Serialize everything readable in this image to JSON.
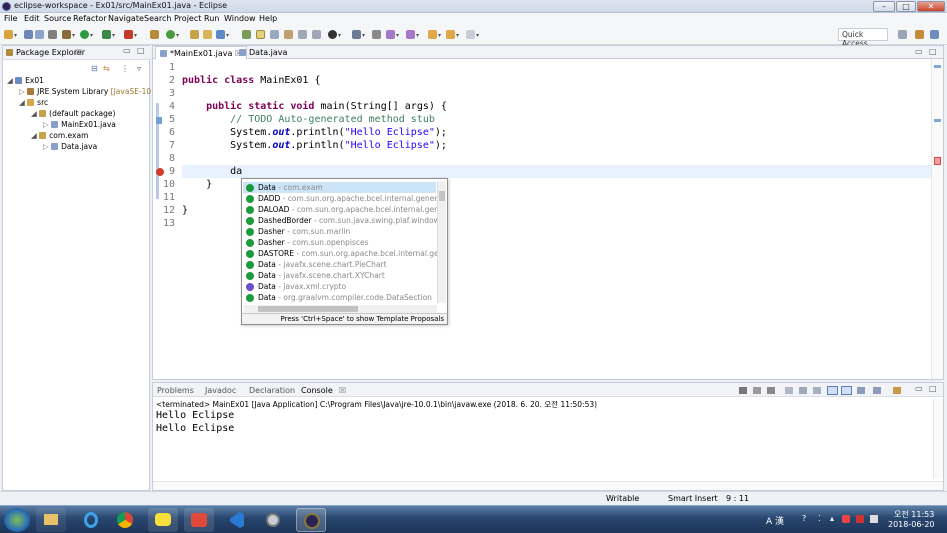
{
  "window": {
    "title": "eclipse-workspace - Ex01/src/MainEx01.java - Eclipse"
  },
  "menu": [
    "File",
    "Edit",
    "Source",
    "Refactor",
    "Navigate",
    "Search",
    "Project",
    "Run",
    "Window",
    "Help"
  ],
  "toolbar": {
    "quick_access": "Quick Access"
  },
  "package_explorer": {
    "title": "Package Explorer",
    "tree": [
      {
        "label": "Ex01",
        "icon": "project-icon"
      },
      {
        "label": "JRE System Library",
        "suffix": "[JavaSE-10]",
        "icon": "library-icon"
      },
      {
        "label": "src",
        "icon": "source-folder-icon"
      },
      {
        "label": "(default package)",
        "icon": "package-icon"
      },
      {
        "label": "MainEx01.java",
        "icon": "java-file-icon"
      },
      {
        "label": "com.exam",
        "icon": "package-icon"
      },
      {
        "label": "Data.java",
        "icon": "java-file-icon"
      }
    ]
  },
  "editor": {
    "tabs": [
      {
        "label": "*MainEx01.java"
      },
      {
        "label": "Data.java"
      }
    ],
    "line_numbers": [
      "1",
      "2",
      "3",
      "4",
      "5",
      "6",
      "7",
      "8",
      "9",
      "10",
      "11",
      "12",
      "13"
    ],
    "lines": {
      "l2a": "public class ",
      "l2b": "MainEx01 {",
      "l4a": "    public static void ",
      "l4b": "main(String[] args) {",
      "l5": "        // TODO Auto-generated method stub",
      "l6a": "        System.",
      "l6b": "out",
      ".l6c": "",
      "l6c": ".println(",
      "l6d": "\"Hello Eclipse\"",
      "l6e": ");",
      "l7a": "        System.",
      "l7b": "out",
      "l7c": ".println(",
      "l7d": "\"Hello Eclipse\"",
      "l7e": ");",
      "l9": "        da",
      "l10": "    }",
      "l12": "}"
    }
  },
  "content_assist": {
    "items": [
      {
        "name": "Data",
        "detail": " - com.exam",
        "kind": "class"
      },
      {
        "name": "DADD",
        "detail": " - com.sun.org.apache.bcel.internal.generic",
        "kind": "class"
      },
      {
        "name": "DALOAD",
        "detail": " - com.sun.org.apache.bcel.internal.generic",
        "kind": "class"
      },
      {
        "name": "DashedBorder",
        "detail": " - com.sun.java.swing.plaf.windows.Windo",
        "kind": "class"
      },
      {
        "name": "Dasher",
        "detail": " - com.sun.marlin",
        "kind": "class"
      },
      {
        "name": "Dasher",
        "detail": " - com.sun.openpisces",
        "kind": "class"
      },
      {
        "name": "DASTORE",
        "detail": " - com.sun.org.apache.bcel.internal.generic",
        "kind": "class"
      },
      {
        "name": "Data",
        "detail": " - javafx.scene.chart.PieChart",
        "kind": "class"
      },
      {
        "name": "Data",
        "detail": " - javafx.scene.chart.XYChart",
        "kind": "class"
      },
      {
        "name": "Data",
        "detail": " - javax.xml.crypto",
        "kind": "interface"
      },
      {
        "name": "Data",
        "detail": " - org.graalvm.compiler.code.DataSection",
        "kind": "class"
      }
    ],
    "footer": "Press 'Ctrl+Space' to show Template Proposals"
  },
  "console": {
    "tabs": [
      "Problems",
      "Javadoc",
      "Declaration",
      "Console"
    ],
    "terminated": "<terminated> MainEx01 [Java Application] C:\\Program Files\\Java\\jre-10.0.1\\bin\\javaw.exe (2018. 6. 20. 오전 11:50:53)",
    "output": [
      "Hello Eclipse",
      "Hello Eclipse"
    ]
  },
  "status": {
    "writable": "Writable",
    "insert": "Smart Insert",
    "position": "9 : 11"
  },
  "tray": {
    "time": "오전 11:53",
    "date": "2018-06-20",
    "ime": "A 漢"
  }
}
